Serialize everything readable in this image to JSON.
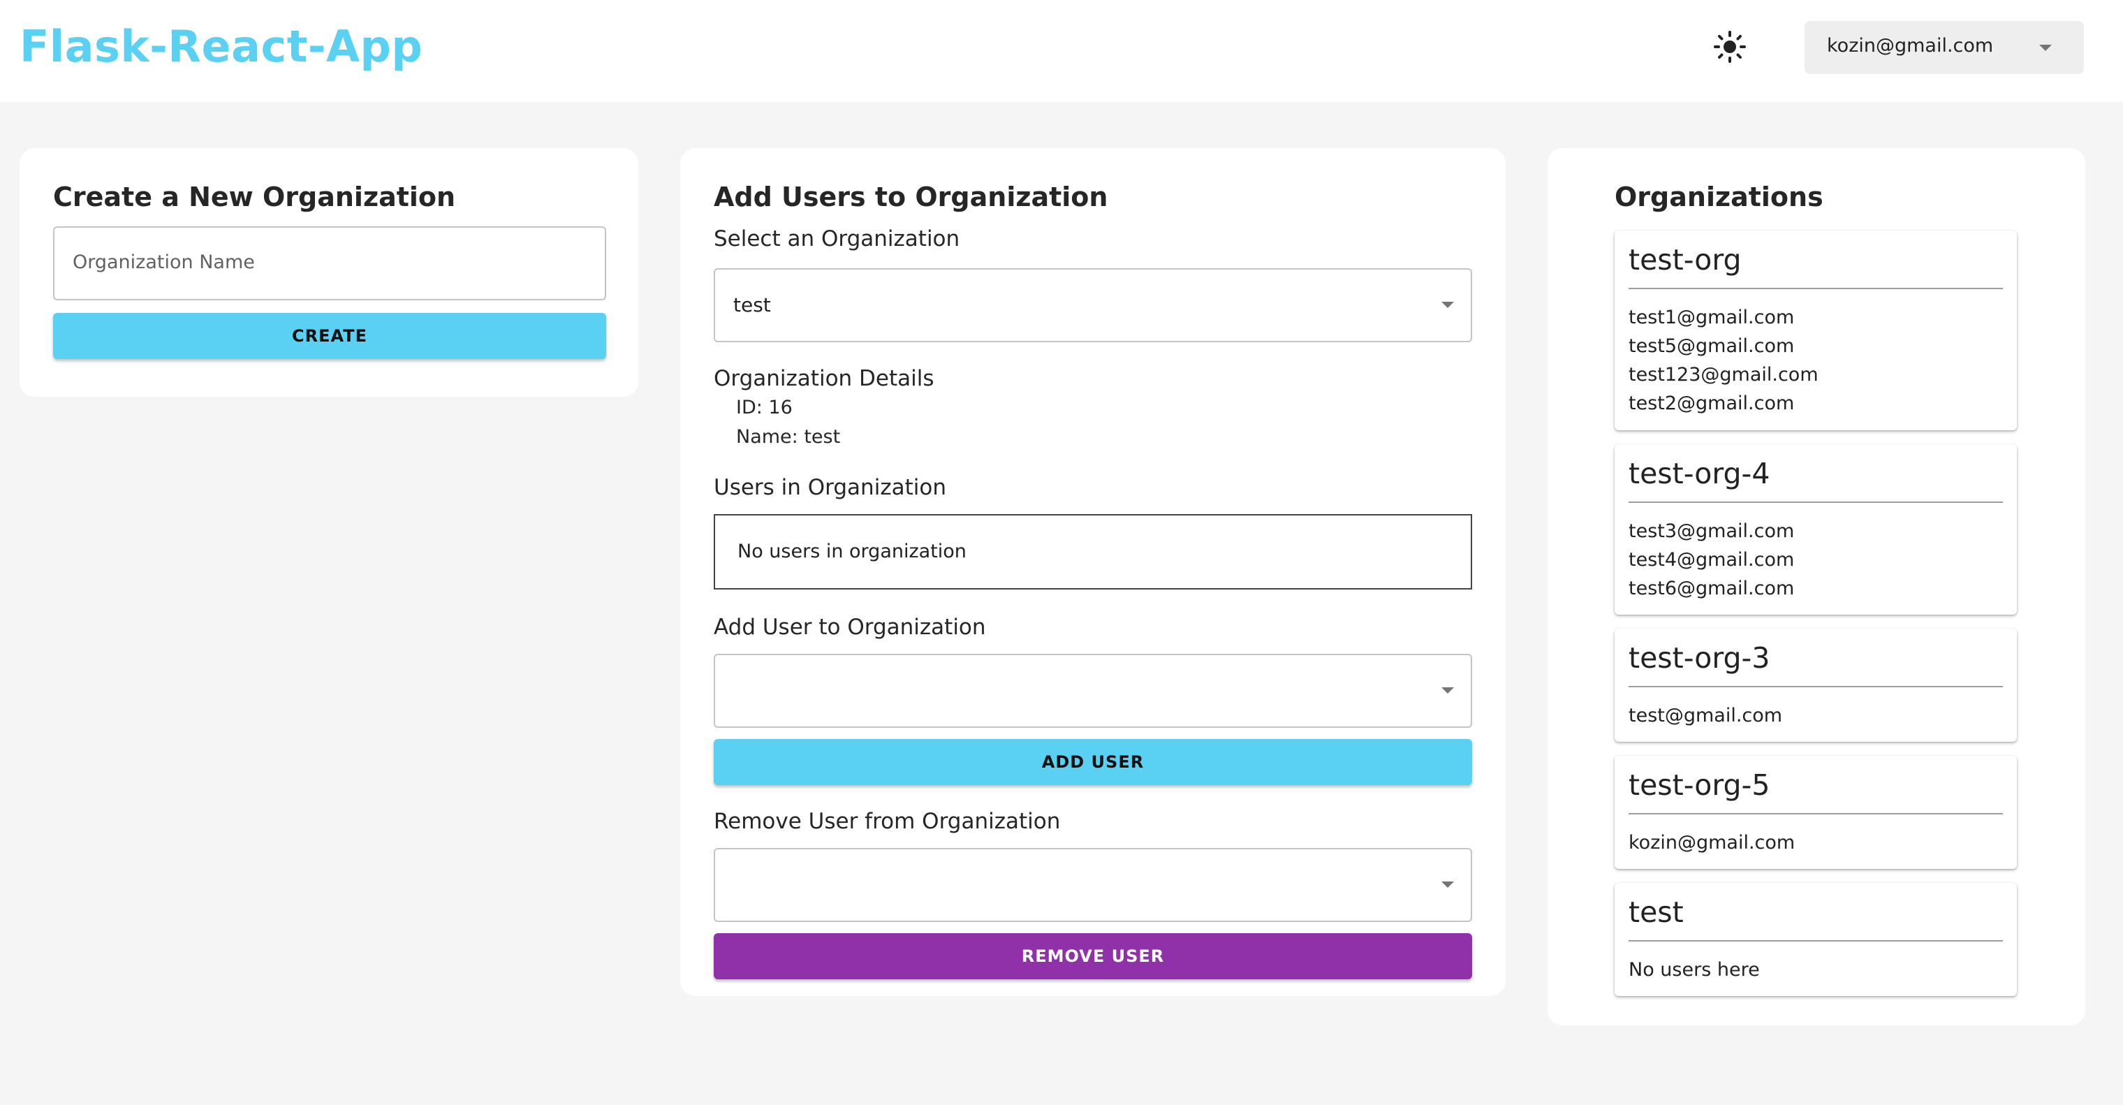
{
  "app": {
    "title": "Flask-React-App",
    "brand_color": "#5ad0f2",
    "theme_icon": "sun-icon",
    "current_user": "kozin@gmail.com"
  },
  "create_org": {
    "title": "Create a New Organization",
    "name_placeholder": "Organization Name",
    "name_value": "",
    "create_label": "CREATE"
  },
  "add_users": {
    "title": "Add Users to Organization",
    "select_label": "Select an Organization",
    "selected_org": "test",
    "details_label": "Organization Details",
    "detail_id": "ID: 16",
    "detail_name": "Name: test",
    "users_label": "Users in Organization",
    "no_users_text": "No users in organization",
    "add_user_label": "Add User to Organization",
    "add_user_value": "",
    "add_button": "ADD USER",
    "remove_user_label": "Remove User from Organization",
    "remove_user_value": "",
    "remove_button": "REMOVE USER",
    "accent_blue": "#5ad0f2",
    "accent_purple": "#9031aa"
  },
  "organizations": {
    "title": "Organizations",
    "items": [
      {
        "name": "test-org",
        "users": [
          "test1@gmail.com",
          "test5@gmail.com",
          "test123@gmail.com",
          "test2@gmail.com"
        ]
      },
      {
        "name": "test-org-4",
        "users": [
          "test3@gmail.com",
          "test4@gmail.com",
          "test6@gmail.com"
        ]
      },
      {
        "name": "test-org-3",
        "users": [
          "test@gmail.com"
        ]
      },
      {
        "name": "test-org-5",
        "users": [
          "kozin@gmail.com"
        ]
      },
      {
        "name": "test",
        "users": [
          "No users here"
        ]
      }
    ]
  }
}
